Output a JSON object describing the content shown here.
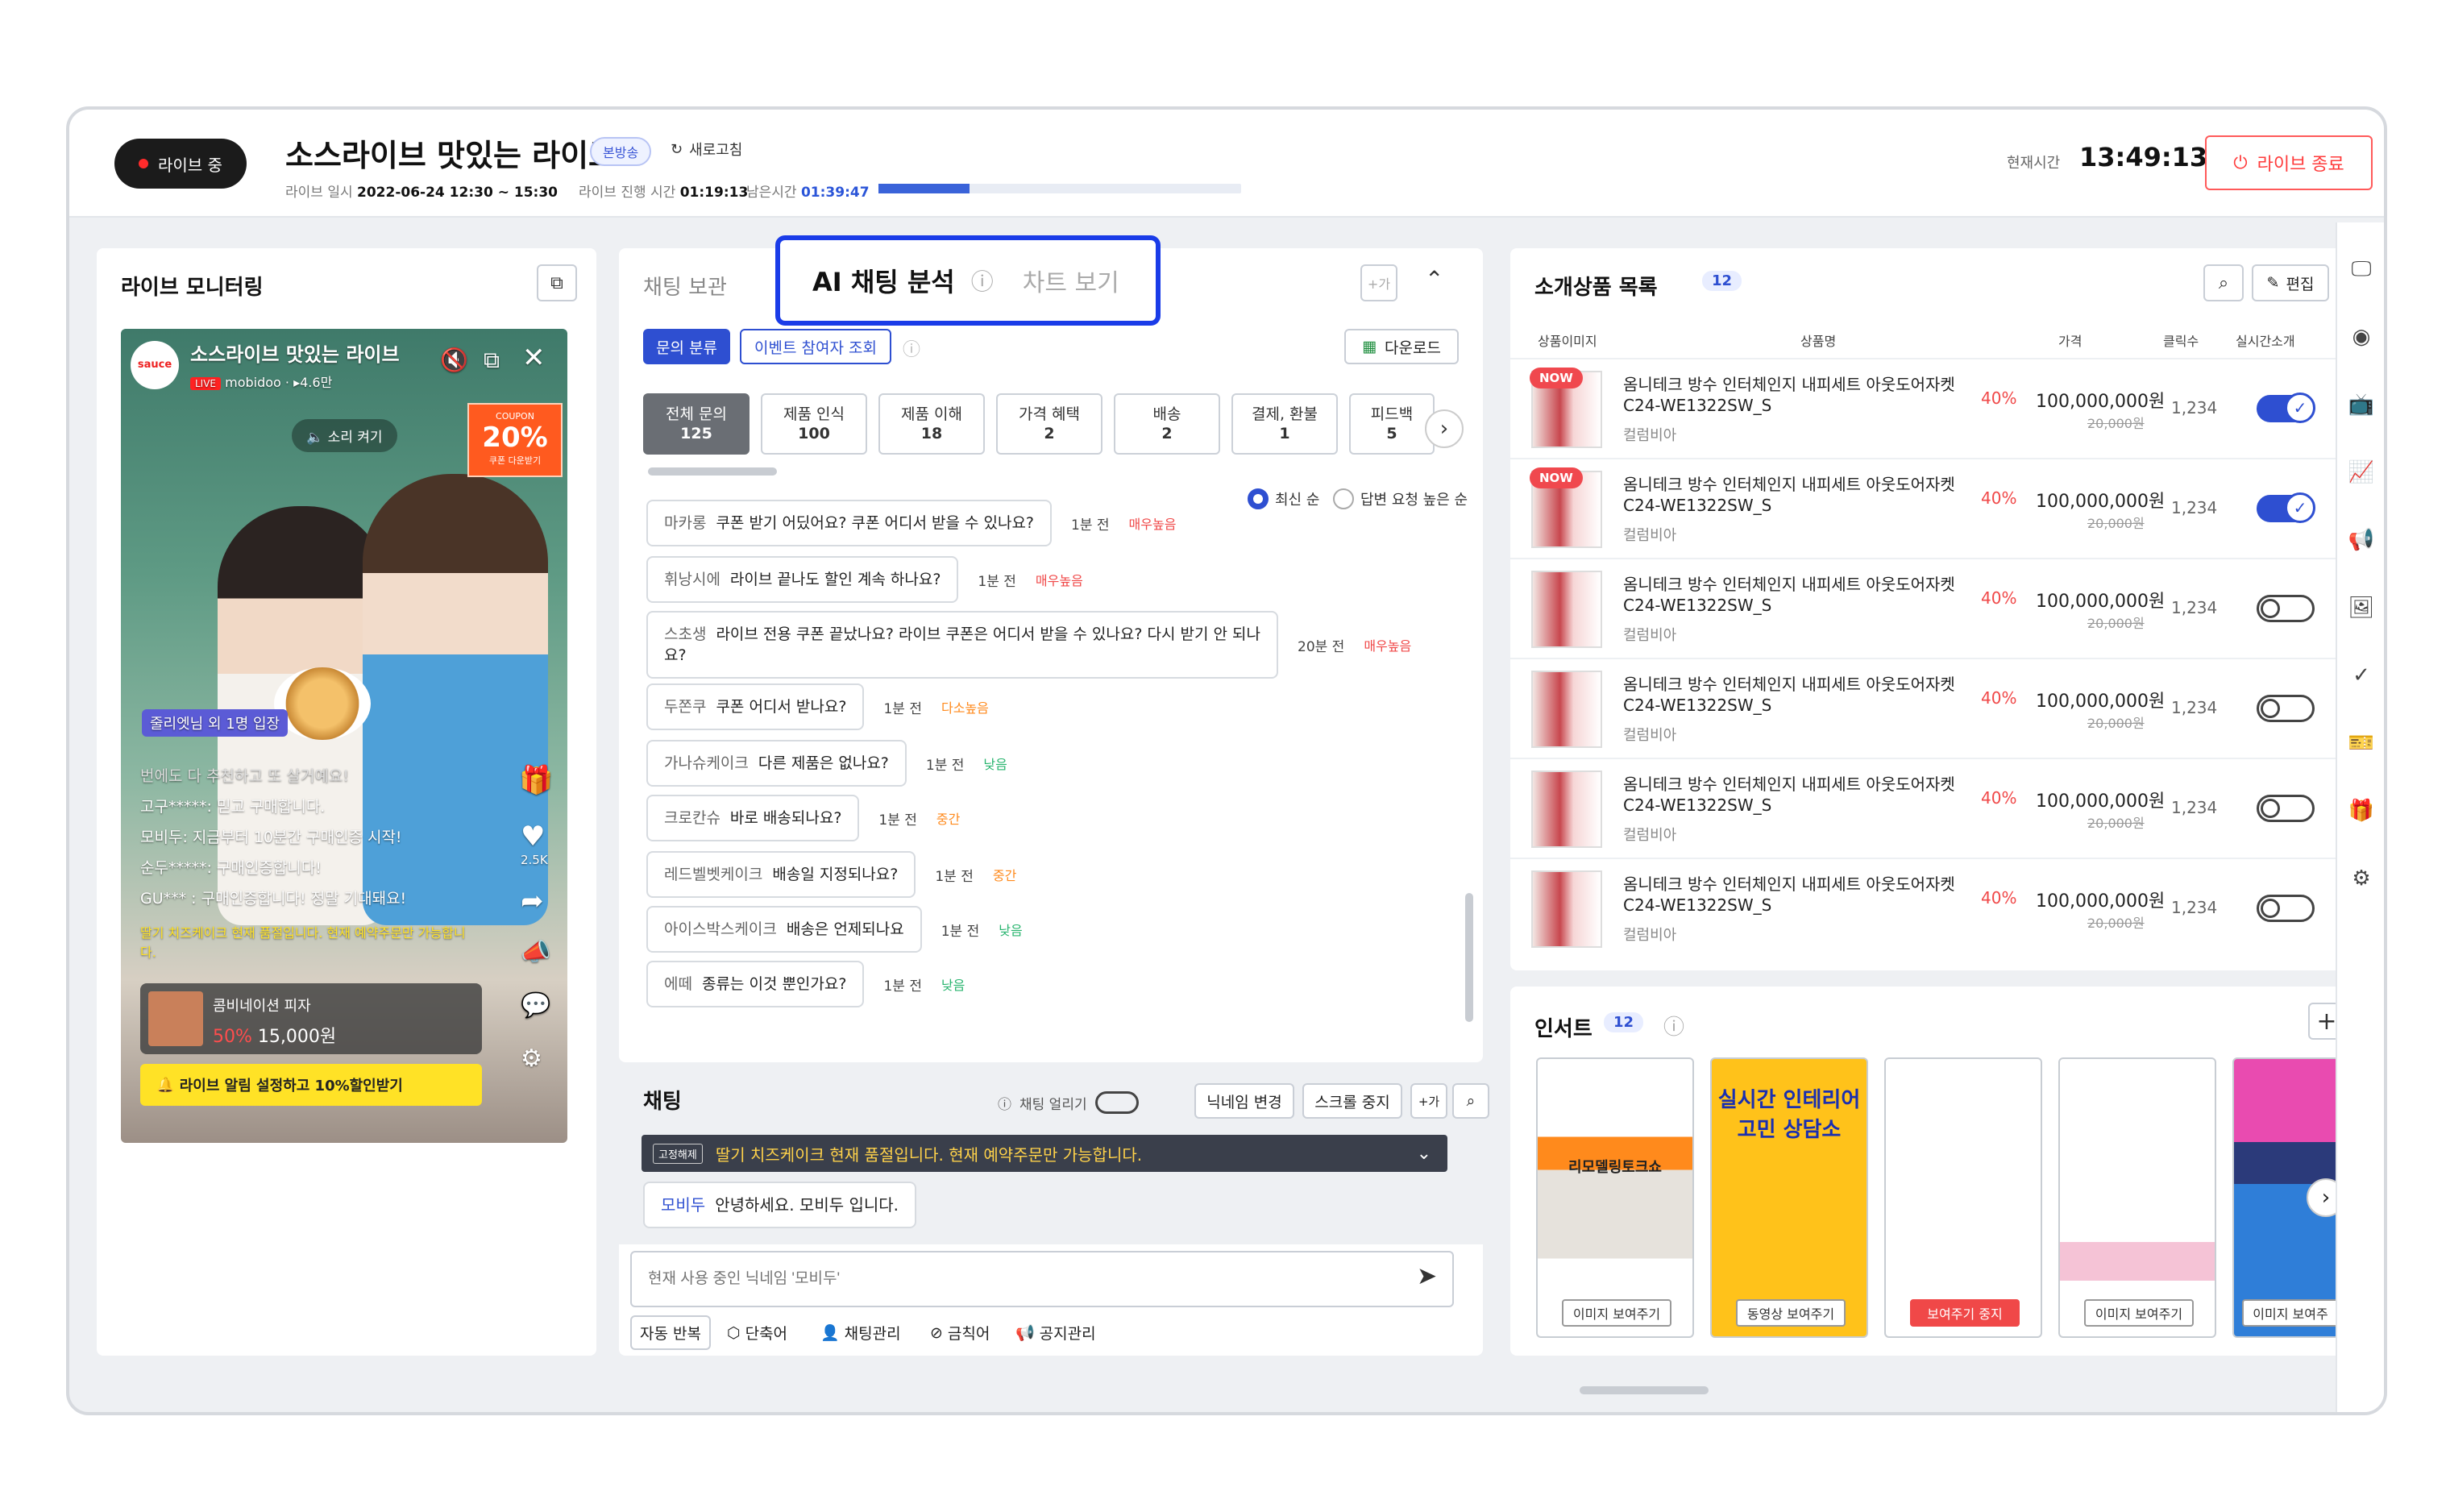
{
  "header": {
    "live_badge": "라이브 중",
    "title": "소스라이브 맛있는 라이브",
    "status_pill": "본방송",
    "refresh": "새로고침",
    "date_label": "라이브 일시",
    "date_value": "2022-06-24 12:30 ~ 15:30",
    "elapsed_label": "라이브 진행 시간",
    "elapsed_value": "01:19:13",
    "remain_label": "남은시간",
    "remain_value": "01:39:47",
    "progress": 0.25,
    "now_label": "현재시간",
    "now_value": "13:49:13",
    "end_button": "라이브 종료"
  },
  "monitor": {
    "title": "라이브 모니터링",
    "stream_title": "소스라이브 맛있는 라이브",
    "live_tag": "LIVE",
    "channel": "mobidoo",
    "viewers": "4.6만",
    "logo": "sauce",
    "sound_on": "소리 켜기",
    "coupon_label": "COUPON",
    "coupon_value": "20%",
    "coupon_sub": "쿠폰 다운받기",
    "join_msg": "줄리엣님 외 1명 입장",
    "comments": [
      "번에도 다 추천하고 또 살거예요!",
      "고구*****: 믿고 구매합니다.",
      "모비두: 지금부터 10분간 구매인증 시작!",
      "순두*****: 구매인증합니다!",
      "GU*** : 구매인증합니다! 정말 기대돼요!"
    ],
    "notice": "딸기 치즈케이크 현재 품절입니다. 현재 예약주문만 가능합니다.",
    "likes": "2.5K",
    "product_name": "콤비네이션 피자",
    "product_disc": "50%",
    "product_price": "15,000원",
    "banner": "라이브 알림 설정하고 10%할인받기"
  },
  "chat_panel": {
    "tab_hidden": "채팅 보관",
    "tab_ai": "AI 채팅 분석",
    "tab_chart": "차트 보기",
    "filter_active": "문의 분류",
    "filter_event": "이벤트 참여자 조회",
    "download": "다운로드",
    "plus_btn": "+가",
    "categories": [
      {
        "name": "전체 문의",
        "count": "125"
      },
      {
        "name": "제품 인식",
        "count": "100"
      },
      {
        "name": "제품 이해",
        "count": "18"
      },
      {
        "name": "가격 혜택",
        "count": "2"
      },
      {
        "name": "배송",
        "count": "2"
      },
      {
        "name": "결제, 환불",
        "count": "1"
      },
      {
        "name": "피드백",
        "count": "5"
      }
    ],
    "sort_recent": "최신 순",
    "sort_request": "답변 요청 높은 순",
    "questions": [
      {
        "nick": "마카롱",
        "text": "쿠폰 받기 어딨어요? 쿠폰 어디서 받을 수 있나요?",
        "time": "1분 전",
        "level": "매우높음",
        "color": "red"
      },
      {
        "nick": "휘낭시에",
        "text": "라이브 끝나도 할인 계속 하나요?",
        "time": "1분 전",
        "level": "매우높음",
        "color": "red"
      },
      {
        "nick": "스초생",
        "text": "라이브 전용 쿠폰 끝났나요? 라이브 쿠폰은 어디서 받을 수 있나요? 다시 받기 안 되나요?",
        "time": "20분 전",
        "level": "매우높음",
        "color": "red"
      },
      {
        "nick": "두쫀쿠",
        "text": "쿠폰 어디서 받나요?",
        "time": "1분 전",
        "level": "다소높음",
        "color": "orange"
      },
      {
        "nick": "가나슈케이크",
        "text": "다른 제품은 없나요?",
        "time": "1분 전",
        "level": "낮음",
        "color": "green"
      },
      {
        "nick": "크로칸슈",
        "text": "바로 배송되나요?",
        "time": "1분 전",
        "level": "중간",
        "color": "orange"
      },
      {
        "nick": "레드벨벳케이크",
        "text": "배송일 지정되나요?",
        "time": "1분 전",
        "level": "중간",
        "color": "orange"
      },
      {
        "nick": "아이스박스케이크",
        "text": "배송은 언제되나요",
        "time": "1분 전",
        "level": "낮음",
        "color": "green"
      },
      {
        "nick": "에떼",
        "text": "종류는 이것 뿐인가요?",
        "time": "1분 전",
        "level": "낮음",
        "color": "green"
      }
    ],
    "chat_title": "채팅",
    "chat_freeze": "채팅 얼리기",
    "nick_change": "닉네임 변경",
    "scroll_stop": "스크롤 중지",
    "pinned_label": "고정해제",
    "pinned_text": "딸기 치즈케이크 현재 품절입니다. 현재 예약주문만 가능합니다.",
    "last_msg_nick": "모비두",
    "last_msg_text": "안녕하세요. 모비두 입니다.",
    "input_placeholder": "현재 사용 중인 닉네임 '모비두'",
    "tools": [
      "자동 반복",
      "단축어",
      "채팅관리",
      "금칙어",
      "공지관리"
    ]
  },
  "products": {
    "title": "소개상품 목록",
    "count": "12",
    "edit": "편집",
    "cols": [
      "상품이미지",
      "상품명",
      "가격",
      "클릭수",
      "실시간소개"
    ],
    "items": [
      {
        "now": "NOW",
        "name": "옴니테크 방수 인터체인지 내피세트 아웃도어자켓 C24-WE1322SW_S",
        "brand": "컬럼비아",
        "disc": "40%",
        "price": "100,000,000원",
        "orig": "20,000원",
        "clicks": "1,234",
        "on": true
      },
      {
        "now": "NOW",
        "name": "옴니테크 방수 인터체인지 내피세트 아웃도어자켓 C24-WE1322SW_S",
        "brand": "컬럼비아",
        "disc": "40%",
        "price": "100,000,000원",
        "orig": "20,000원",
        "clicks": "1,234",
        "on": true
      },
      {
        "now": "",
        "name": "옴니테크 방수 인터체인지 내피세트 아웃도어자켓 C24-WE1322SW_S",
        "brand": "컬럼비아",
        "disc": "40%",
        "price": "100,000,000원",
        "orig": "20,000원",
        "clicks": "1,234",
        "on": false
      },
      {
        "now": "",
        "name": "옴니테크 방수 인터체인지 내피세트 아웃도어자켓 C24-WE1322SW_S",
        "brand": "컬럼비아",
        "disc": "40%",
        "price": "100,000,000원",
        "orig": "20,000원",
        "clicks": "1,234",
        "on": false
      },
      {
        "now": "",
        "name": "옴니테크 방수 인터체인지 내피세트 아웃도어자켓 C24-WE1322SW_S",
        "brand": "컬럼비아",
        "disc": "40%",
        "price": "100,000,000원",
        "orig": "20,000원",
        "clicks": "1,234",
        "on": false
      },
      {
        "now": "",
        "name": "옴니테크 방수 인터체인지 내피세트 아웃도어자켓 C24-WE1322SW_S",
        "brand": "컬럼비아",
        "disc": "40%",
        "price": "100,000,000원",
        "orig": "20,000원",
        "clicks": "1,234",
        "on": false
      }
    ]
  },
  "insert": {
    "title": "인서트",
    "count": "12",
    "cards": [
      {
        "btn": "이미지 보여주기",
        "stop": false,
        "text": "리모델링토크쇼"
      },
      {
        "btn": "동영상 보여주기",
        "stop": false,
        "text": "실시간 인테리어 고민 상담소"
      },
      {
        "btn": "보여주기 중지",
        "stop": true,
        "text": ""
      },
      {
        "btn": "이미지 보여주기",
        "stop": false,
        "text": ""
      },
      {
        "btn": "이미지 보여주",
        "stop": false,
        "text": ""
      }
    ]
  },
  "colors": {
    "accent": "#2e4fd1",
    "highlight": "#1a3ce8",
    "danger": "#f04848"
  }
}
